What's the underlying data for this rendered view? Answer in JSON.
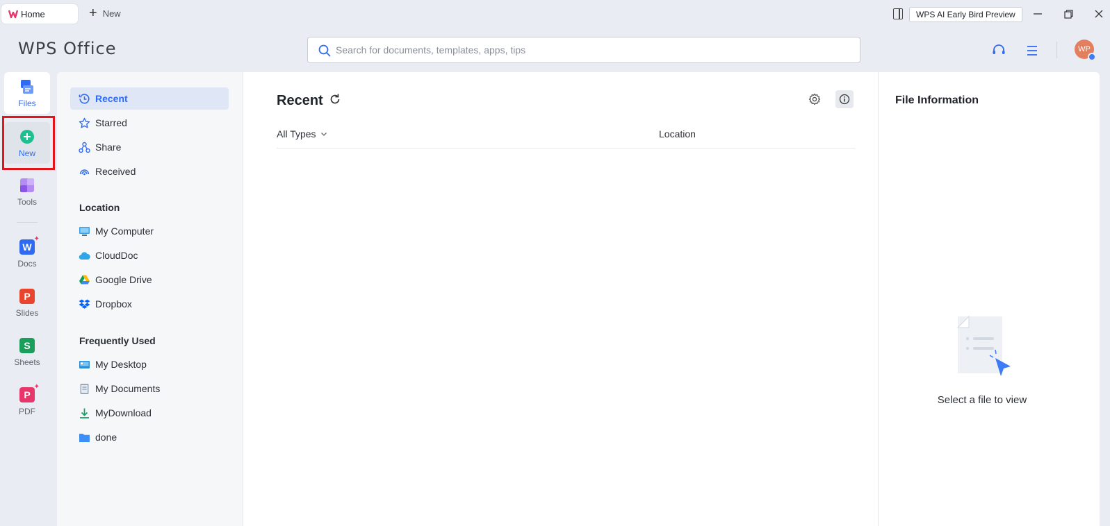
{
  "titlebar": {
    "tabs": [
      {
        "label": "Home"
      },
      {
        "label": "New"
      }
    ],
    "ai_button": "WPS AI Early Bird Preview"
  },
  "header": {
    "brand": "WPS Office",
    "search_placeholder": "Search for documents, templates, apps, tips",
    "avatar_initials": "WP"
  },
  "rail": {
    "items": [
      {
        "label": "Files",
        "icon": "files-icon"
      },
      {
        "label": "New",
        "icon": "plus-circle-icon"
      },
      {
        "label": "Tools",
        "icon": "tools-icon"
      },
      {
        "label": "Docs",
        "icon": "docs-icon",
        "glyph": "W"
      },
      {
        "label": "Slides",
        "icon": "slides-icon",
        "glyph": "P"
      },
      {
        "label": "Sheets",
        "icon": "sheets-icon",
        "glyph": "S"
      },
      {
        "label": "PDF",
        "icon": "pdf-icon",
        "glyph": "P"
      }
    ]
  },
  "nav": {
    "items": [
      {
        "label": "Recent",
        "icon": "clock-icon"
      },
      {
        "label": "Starred",
        "icon": "star-icon"
      },
      {
        "label": "Share",
        "icon": "share-icon"
      },
      {
        "label": "Received",
        "icon": "received-icon"
      }
    ],
    "location_heading": "Location",
    "locations": [
      {
        "label": "My Computer",
        "icon": "monitor-icon"
      },
      {
        "label": "CloudDoc",
        "icon": "cloud-icon"
      },
      {
        "label": "Google Drive",
        "icon": "google-drive-icon"
      },
      {
        "label": "Dropbox",
        "icon": "dropbox-icon"
      }
    ],
    "frequent_heading": "Frequently Used",
    "frequent": [
      {
        "label": "My Desktop",
        "icon": "desktop-icon"
      },
      {
        "label": "My Documents",
        "icon": "documents-icon"
      },
      {
        "label": "MyDownload",
        "icon": "download-icon"
      },
      {
        "label": "done",
        "icon": "folder-icon"
      }
    ]
  },
  "main": {
    "title": "Recent",
    "filter_label": "All Types",
    "location_column": "Location"
  },
  "info_panel": {
    "title": "File Information",
    "empty_text": "Select a file to view"
  },
  "colors": {
    "accent": "#2f6bf2",
    "highlight_box": "#e3151b",
    "new_green": "#1fbf8f"
  }
}
